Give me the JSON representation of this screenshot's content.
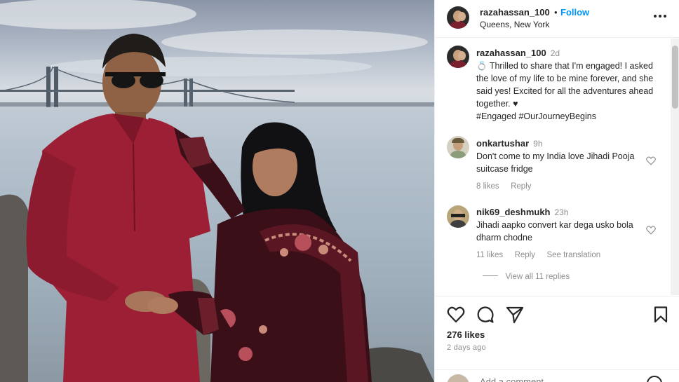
{
  "post_header": {
    "username": "razahassan_100",
    "separator": "•",
    "follow_label": "Follow",
    "location": "Queens, New York"
  },
  "caption": {
    "username": "razahassan_100",
    "time": "2d",
    "emoji": "💍",
    "text": "Thrilled to share that I'm engaged! I asked the love of my life to be mine forever, and she said yes! Excited for all the adventures ahead together. ♥",
    "hashtags": "#Engaged #OurJourneyBegins"
  },
  "comments": [
    {
      "username": "onkartushar",
      "time": "9h",
      "text": "Don't come to my India love Jihadi Pooja suitcase fridge",
      "likes": "8 likes",
      "reply_label": "Reply"
    },
    {
      "username": "nik69_deshmukh",
      "time": "23h",
      "text": "Jihadi aapko convert kar dega usko bola dharm chodne",
      "likes": "11 likes",
      "reply_label": "Reply",
      "translation_label": "See translation",
      "view_replies_label": "View all 11 replies"
    }
  ],
  "actions": {
    "like_count": "276 likes",
    "posted_ago": "2 days ago",
    "add_comment_placeholder": "Add a comment..."
  },
  "icons": {
    "more": "more-options-icon",
    "like": "heart-icon",
    "comment": "comment-icon",
    "share": "paper-plane-icon",
    "save": "bookmark-icon",
    "emoji": "emoji-icon"
  },
  "colors": {
    "follow_blue": "#0095f6",
    "text_dark": "#262626",
    "text_gray": "#8e8e8e",
    "kurta_red": "#9c1f35",
    "velvet_maroon": "#3b0f18"
  }
}
